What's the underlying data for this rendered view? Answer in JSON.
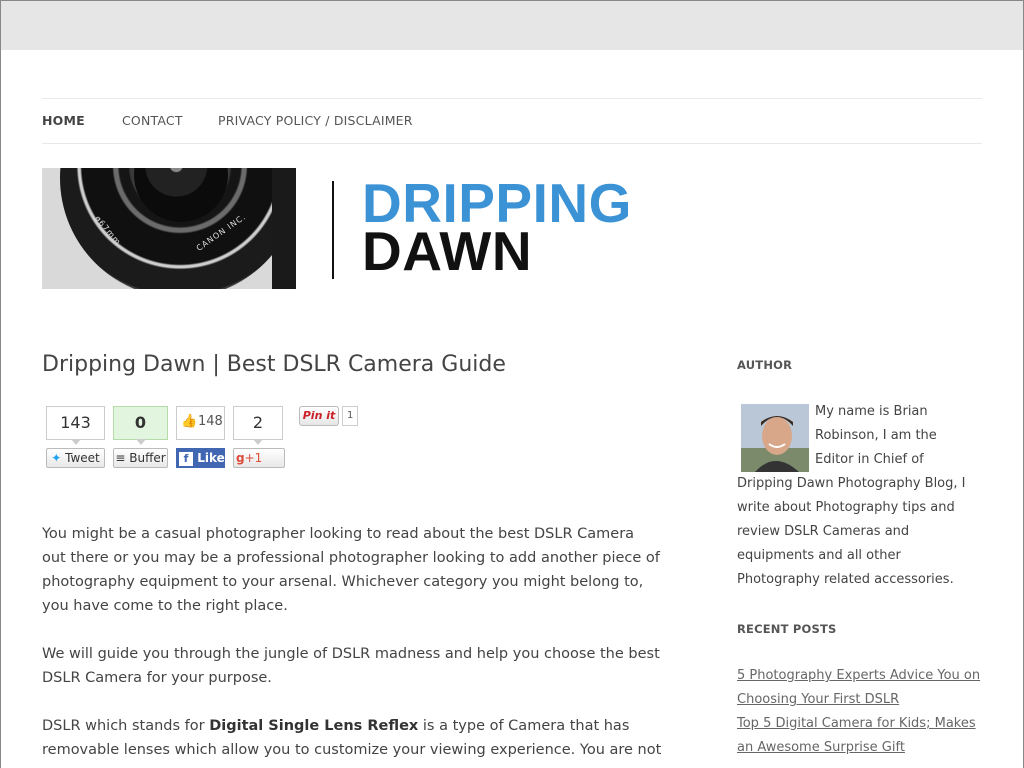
{
  "nav": {
    "items": [
      {
        "label": "HOME",
        "active": true
      },
      {
        "label": "CONTACT",
        "active": false
      },
      {
        "label": "PRIVACY POLICY / DISCLAIMER",
        "active": false
      }
    ]
  },
  "header": {
    "lens_text_1": "CANON INC.",
    "lens_text_2": "ø67mm",
    "logo_line1": "DRIPPING",
    "logo_line2": "DAWN",
    "logo_colors": {
      "line1": "#3b93d6",
      "line2": "#111111"
    }
  },
  "post": {
    "title": "Dripping Dawn | Best DSLR Camera Guide",
    "paragraph1": "You might be a casual photographer looking to read about the best DSLR Camera out there or you may be a professional photographer looking to add another piece of photography equipment to your arsenal. Whichever category you might belong to, you have come to the right place.",
    "paragraph2": "We will guide you through the jungle of DSLR madness and help you choose the best DSLR Camera for your purpose.",
    "paragraph3_pre": "DSLR which stands for ",
    "paragraph3_bold": "Digital Single Lens Reflex",
    "paragraph3_post": " is a type of Camera that has removable lenses which allow you to customize your viewing experience. You are not"
  },
  "share": {
    "tweet": {
      "count": "143",
      "label": "Tweet"
    },
    "buffer": {
      "count": "0",
      "label": "Buffer"
    },
    "facebook": {
      "count": "148",
      "label": "Like"
    },
    "gplus": {
      "count": "2",
      "label": "+1"
    },
    "pinterest": {
      "label": "Pin it",
      "count": "1"
    }
  },
  "sidebar": {
    "author_heading": "AUTHOR",
    "author_bio": "My name is Brian Robinson, I am the Editor in Chief of Dripping Dawn Photography Blog, I write about Photography tips and review DSLR Cameras and equipments and all other Photography related accessories.",
    "recent_heading": "RECENT POSTS",
    "recent_posts": [
      "5 Photography Experts Advice You on Choosing Your First DSLR",
      "Top 5 Digital Camera for Kids; Makes an Awesome Surprise Gift"
    ]
  }
}
